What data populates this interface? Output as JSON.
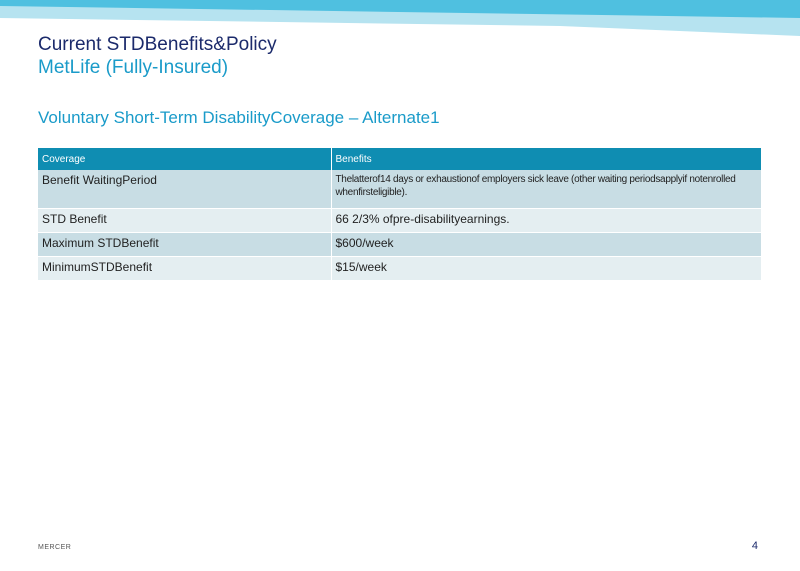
{
  "slide": {
    "title": "Current STDBenefits&Policy",
    "carrier": "MetLife (Fully-Insured)",
    "subtitle": "Voluntary Short-Term DisabilityCoverage – Alternate1",
    "footer_brand": "MERCER",
    "page_number": "4"
  },
  "table": {
    "headers": [
      "Coverage",
      "Benefits"
    ],
    "rows": [
      [
        "Benefit WaitingPeriod",
        "Thelatterof14 days or exhaustionof employers sick leave (other waiting periodsapplyif notenrolled whenfirsteligible)."
      ],
      [
        "STD Benefit",
        "66 2/3% ofpre-disabilityearnings."
      ],
      [
        "Maximum STDBenefit",
        "$600/week"
      ],
      [
        "MinimumSTDBenefit",
        "$15/week"
      ]
    ]
  },
  "colors": {
    "title": "#1b2a6b",
    "accent": "#1a9bc9",
    "header_fill": "#0f8db2",
    "row_dark": "#c8dde4",
    "row_light": "#e4eef1"
  }
}
